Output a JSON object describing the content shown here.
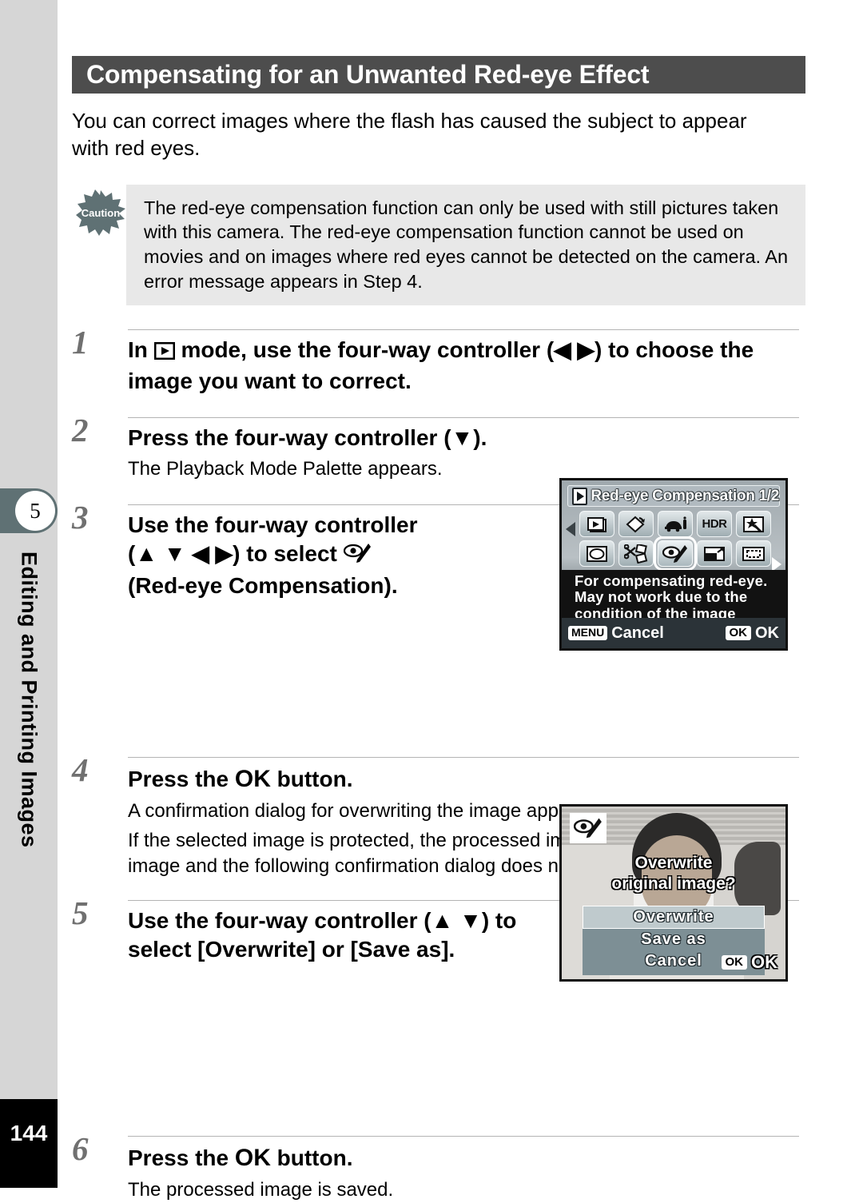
{
  "sidebar": {
    "chapter_number": "5",
    "chapter_title": "Editing and Printing Images",
    "page_number": "144"
  },
  "heading": {
    "title": "Compensating for an Unwanted Red-eye Effect"
  },
  "intro": {
    "text": "You can correct images where the flash has caused the subject to appear with red eyes."
  },
  "caution": {
    "icon_label": "Caution",
    "text": "The red-eye compensation function can only be used with still pictures taken with this camera. The red-eye compensation function cannot be used on movies and on images where red eyes cannot be detected on the camera. An error message appears in Step 4."
  },
  "steps": [
    {
      "number": "1",
      "title_before": "In",
      "title_after": "mode, use the four-way controller (◀ ▶) to choose the image you want to correct.",
      "desc": ""
    },
    {
      "number": "2",
      "title": "Press the four-way controller (▼).",
      "desc": "The Playback Mode Palette appears."
    },
    {
      "number": "3",
      "title_a": "Use the four-way controller",
      "title_b": "(▲ ▼ ◀ ▶) to select",
      "title_c": "(Red-eye Compensation).",
      "desc": ""
    },
    {
      "number": "4",
      "title_before": "Press the",
      "title_key": "OK",
      "title_after": "button.",
      "desc_line1": "A confirmation dialog for overwriting the image appears.",
      "desc_line2": "If the selected image is protected, the processed image is saved as a new image and the following confirmation dialog does not appear."
    },
    {
      "number": "5",
      "title": "Use the four-way controller (▲ ▼) to select [Overwrite] or [Save as].",
      "desc": ""
    },
    {
      "number": "6",
      "title_before": "Press the",
      "title_key": "OK",
      "title_after": "button.",
      "desc": "The processed image is saved."
    }
  ],
  "lcd_palette": {
    "title": "Red-eye Compensation 1/2",
    "page_indicator": "1/2",
    "icons_row1": [
      "slideshow-icon",
      "image-rotation-icon",
      "ink-rubbing-filter-icon",
      "hdr-icon",
      "digital-filter-icon"
    ],
    "icons_row2": [
      "frame-composite-icon",
      "collage-icon",
      "red-eye-compensation-icon",
      "resize-icon",
      "cropping-icon"
    ],
    "hdr_label": "HDR",
    "selected_icon": "red-eye-compensation-icon",
    "message_line1": "For compensating red-eye.",
    "message_line2": "May not work due to the",
    "message_line3": "condition of the image",
    "menu_key": "MENU",
    "cancel_label": "Cancel",
    "ok_key": "OK",
    "ok_label": "OK"
  },
  "lcd_overwrite": {
    "badge_icon": "red-eye-compensation-icon",
    "question_line1": "Overwrite",
    "question_line2": "original image?",
    "options": [
      "Overwrite",
      "Save as",
      "Cancel"
    ],
    "selected_option": "Overwrite",
    "ok_key": "OK",
    "ok_label": "OK"
  },
  "colors": {
    "heading_bar": "#4d4d4d",
    "sidebar": "#d6d6d6",
    "chapter_tab": "#5f7174",
    "caution_bg": "#e8e8e8",
    "step_number": "#707070"
  }
}
